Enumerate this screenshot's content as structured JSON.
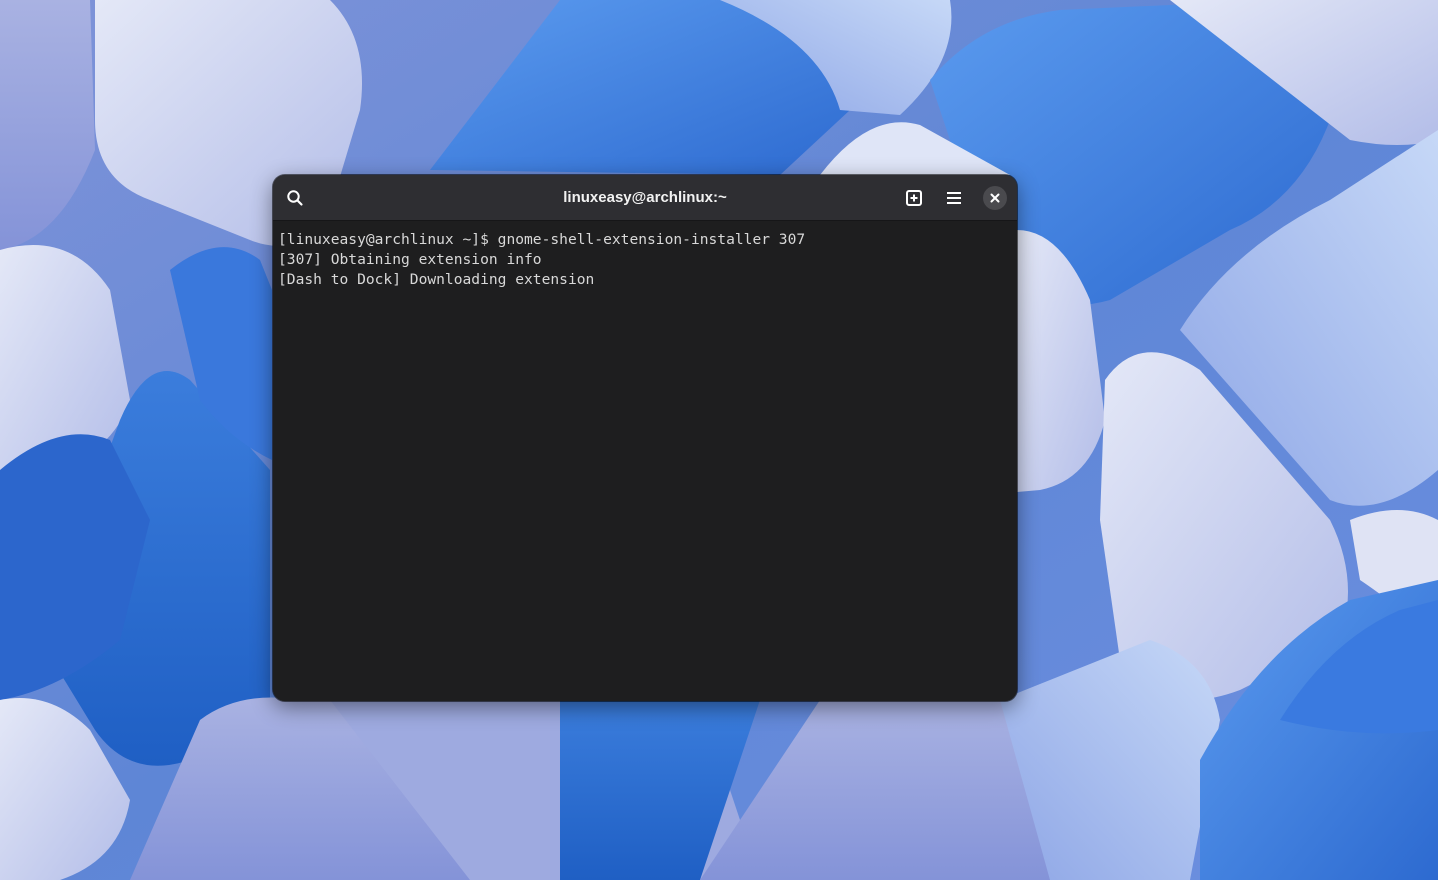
{
  "window": {
    "title": "linuxeasy@archlinux:~"
  },
  "headerbar": {
    "search_icon": "search-icon",
    "new_tab_icon": "new-tab-icon",
    "menu_icon": "hamburger-menu-icon",
    "close_icon": "close-icon"
  },
  "terminal": {
    "lines": [
      "[linuxeasy@archlinux ~]$ gnome-shell-extension-installer 307",
      "[307] Obtaining extension info",
      "[Dash to Dock] Downloading extension"
    ]
  },
  "colors": {
    "terminal_background": "#1e1e1f",
    "headerbar_background": "#2e2e32",
    "text": "#d8d8d8",
    "wallpaper_blue": "#2f6fd0"
  }
}
